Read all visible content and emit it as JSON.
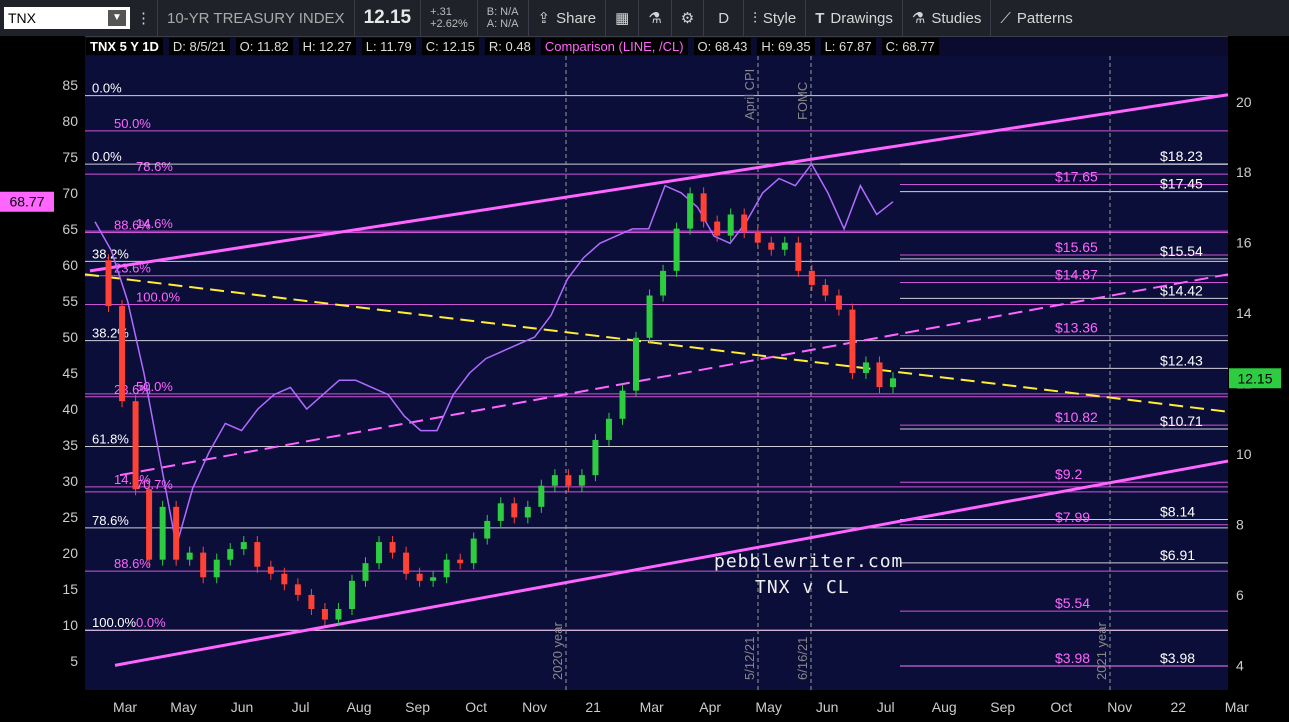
{
  "toolbar": {
    "symbol": "TNX",
    "name": "10-YR TREASURY INDEX",
    "last": "12.15",
    "change": "+.31",
    "change_pct": "+2.62%",
    "bid": "B: N/A",
    "ask": "A: N/A",
    "share": "Share",
    "period": "D",
    "style": "Style",
    "drawings": "Drawings",
    "studies": "Studies",
    "patterns": "Patterns"
  },
  "legend": {
    "main": "TNX 5 Y 1D",
    "date": "D: 8/5/21",
    "open": "O: 11.82",
    "high": "H: 12.27",
    "low": "L: 11.79",
    "close": "C: 12.15",
    "range": "R: 0.48",
    "comparison": "Comparison (LINE, /CL)",
    "c_open": "O: 68.43",
    "c_high": "H: 69.35",
    "c_low": "L: 67.87",
    "c_close": "C: 68.77"
  },
  "watermark": {
    "line1": "pebblewriter.com",
    "line2": "TNX v CL"
  },
  "badges": {
    "left": "68.77",
    "right": "12.15"
  },
  "chart_data": {
    "type": "line",
    "x_ticks": [
      "Mar",
      "May",
      "Jun",
      "Jul",
      "Aug",
      "Sep",
      "Oct",
      "Nov",
      "21",
      "Mar",
      "Apr",
      "May",
      "Jun",
      "Jul",
      "Aug",
      "Sep",
      "Oct",
      "Nov",
      "22",
      "Mar"
    ],
    "left_axis": {
      "ticks": [
        5,
        10,
        15,
        20,
        25,
        30,
        35,
        40,
        45,
        50,
        55,
        60,
        65,
        70,
        75,
        80,
        85
      ],
      "ylim": [
        1,
        89
      ]
    },
    "right_axis": {
      "ticks": [
        4,
        6,
        8,
        10,
        12,
        14,
        16,
        18,
        20
      ],
      "ylim": [
        3.3,
        21.3
      ]
    },
    "vertical_markers": [
      "April CPI",
      "FOMC",
      "2020 year",
      "5/12/21",
      "6/16/21",
      "2021 year"
    ],
    "left_levels": [
      {
        "label": "0.0%",
        "value": 83.5
      },
      {
        "label": "50.0%",
        "value": 78.6
      },
      {
        "label": "78.6%",
        "value": 72.6
      },
      {
        "label": "0.0%",
        "value": 74
      },
      {
        "label": "88.6%",
        "value": 64.5
      },
      {
        "label": "14.6%",
        "value": 64.7
      },
      {
        "label": "38.2%",
        "value": 60.5
      },
      {
        "label": "23.6%",
        "value": 58.5
      },
      {
        "label": "100.0%",
        "value": 54.5
      },
      {
        "label": "38.2%",
        "value": 49.5
      },
      {
        "label": "23.6%",
        "value": 41.7
      },
      {
        "label": "50.0%",
        "value": 42.1
      },
      {
        "label": "61.8%",
        "value": 34.8
      },
      {
        "label": "14.6%",
        "value": 29.2
      },
      {
        "label": "70.7%",
        "value": 28.5
      },
      {
        "label": "78.6%",
        "value": 23.5
      },
      {
        "label": "88.6%",
        "value": 17.5
      },
      {
        "label": "0.0%",
        "value": 9.3
      },
      {
        "label": "100.0%",
        "value": 9.3
      }
    ],
    "right_levels": [
      {
        "label": "$18.23",
        "value": 18.23
      },
      {
        "label": "$17.65",
        "value": 17.65
      },
      {
        "label": "$17.45",
        "value": 17.45
      },
      {
        "label": "$15.65",
        "value": 15.65
      },
      {
        "label": "$15.54",
        "value": 15.54
      },
      {
        "label": "$14.87",
        "value": 14.87
      },
      {
        "label": "$14.42",
        "value": 14.42
      },
      {
        "label": "$13.36",
        "value": 13.36
      },
      {
        "label": "$12.43",
        "value": 12.43
      },
      {
        "label": "$10.82",
        "value": 10.82
      },
      {
        "label": "$10.71",
        "value": 10.71
      },
      {
        "label": "$9.2",
        "value": 9.2
      },
      {
        "label": "$8.14",
        "value": 8.14
      },
      {
        "label": "$7.99",
        "value": 7.99
      },
      {
        "label": "$6.91",
        "value": 6.91
      },
      {
        "label": "$5.54",
        "value": 5.54
      },
      {
        "label": "$3.98",
        "value": 3.98
      },
      {
        "label": "$3.98",
        "value": 3.98
      }
    ],
    "series": [
      {
        "type": "candlestick",
        "values": [
          15.5,
          14.2,
          11.5,
          9,
          7,
          8.5,
          7,
          7.2,
          6.5,
          7,
          7.3,
          7.5,
          6.8,
          6.6,
          6.3,
          6,
          5.6,
          5.3,
          5.6,
          6.4,
          6.9,
          7.5,
          7.2,
          6.6,
          6.4,
          6.5,
          7,
          6.9,
          7.6,
          8.1,
          8.6,
          8.2,
          8.5,
          9.1,
          9.4,
          9.1,
          9.4,
          10.4,
          11,
          11.8,
          13.3,
          14.5,
          15.2,
          16.4,
          17.4,
          16.6,
          16.2,
          16.8,
          16.3,
          16,
          15.8,
          16,
          15.2,
          14.8,
          14.5,
          14.1,
          12.3,
          12.6,
          11.9,
          12.15
        ]
      },
      {
        "type": "line",
        "values": [
          66,
          62,
          55,
          45,
          33,
          21,
          29,
          34,
          38,
          37,
          40,
          42,
          43,
          40,
          42,
          44,
          44,
          43,
          42,
          39,
          37,
          37,
          42,
          45,
          47,
          48,
          49,
          50,
          53,
          58,
          61,
          63,
          64,
          65,
          65,
          71,
          70,
          68,
          64,
          63,
          66,
          70,
          72,
          71,
          74,
          70,
          65,
          71,
          67,
          68.77
        ]
      }
    ]
  }
}
